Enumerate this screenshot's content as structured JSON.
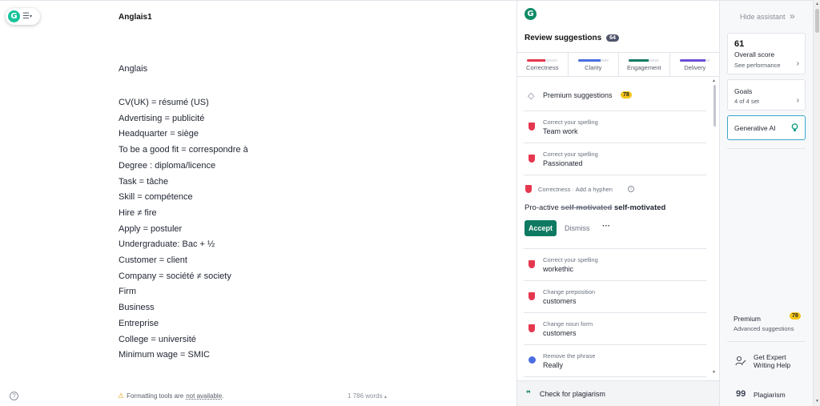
{
  "editor": {
    "document_title": "Anglais1",
    "heading": "Anglais",
    "lines": [
      "CV(UK) = résumé (US)",
      "Advertising = publicité",
      "Headquarter = siège",
      "To be a good fit = correspondre à",
      "Degree : diploma/licence",
      "Task = tâche",
      "Skill = compétence",
      "Hire ≠ fire",
      "Apply = postuler",
      "Undergraduate: Bac + ½",
      "Customer = client",
      "Company = société ≠ society",
      "Firm",
      "Business",
      "Entreprise",
      "College = université",
      "Minimum wage = SMIC"
    ],
    "footer": {
      "notice_prefix": "Formatting tools are",
      "notice_link": "not available",
      "notice_suffix": ".",
      "word_count": "1 786 words",
      "word_count_caret": "▴"
    }
  },
  "icons": {
    "grammarly_logo": "G",
    "menu_lines": "☰",
    "menu_caret": "▾",
    "help": "?",
    "warning": "⚠",
    "gem": "◇",
    "info": "i",
    "more": "···",
    "quote": "❞",
    "scroll_up": "▲",
    "scroll_down": "▼",
    "chevron_right": "›",
    "double_chevron": "»",
    "plagiarism": "99"
  },
  "panel": {
    "title": "Review suggestions",
    "count": "64",
    "categories": [
      {
        "label": "Correctness",
        "color": "#e5384f",
        "fill": 0.6
      },
      {
        "label": "Clarity",
        "color": "#4a6ee0",
        "fill": 0.75
      },
      {
        "label": "Engagement",
        "color": "#0f7a62",
        "fill": 0.65
      },
      {
        "label": "Delivery",
        "color": "#6a4fd6",
        "fill": 0.85
      }
    ],
    "premium_label": "Premium suggestions",
    "premium_count": "78",
    "suggestions_top": [
      {
        "kind": "Correct your spelling",
        "word": "Team work",
        "type": "correctness"
      },
      {
        "kind": "Correct your spelling",
        "word": "Passionated",
        "type": "correctness"
      }
    ],
    "expanded": {
      "kind": "Correctness · Add a hyphen",
      "prefix": "Pro-active ",
      "struck": "self motivated",
      "fix": "self-motivated",
      "accept": "Accept",
      "dismiss": "Dismiss"
    },
    "suggestions_bottom": [
      {
        "kind": "Correct your spelling",
        "word": "workethic",
        "type": "correctness"
      },
      {
        "kind": "Change preposition",
        "word": "customers",
        "type": "correctness"
      },
      {
        "kind": "Change noun form",
        "word": "customers",
        "type": "correctness"
      },
      {
        "kind": "Remove the phrase",
        "word": "Really",
        "type": "clarity"
      }
    ],
    "plagiarism_check": "Check for plagiarism"
  },
  "sidebar": {
    "hide_assistant": "Hide assistant",
    "score": "61",
    "score_label": "Overall score",
    "score_link": "See performance",
    "goals_label": "Goals",
    "goals_sub": "4 of 4 set",
    "genai_label": "Generative AI",
    "premium_label": "Premium",
    "premium_count": "78",
    "premium_sub": "Advanced suggestions",
    "expert_line1": "Get Expert",
    "expert_line2": "Writing Help",
    "plagiarism_label": "Plagiarism"
  }
}
